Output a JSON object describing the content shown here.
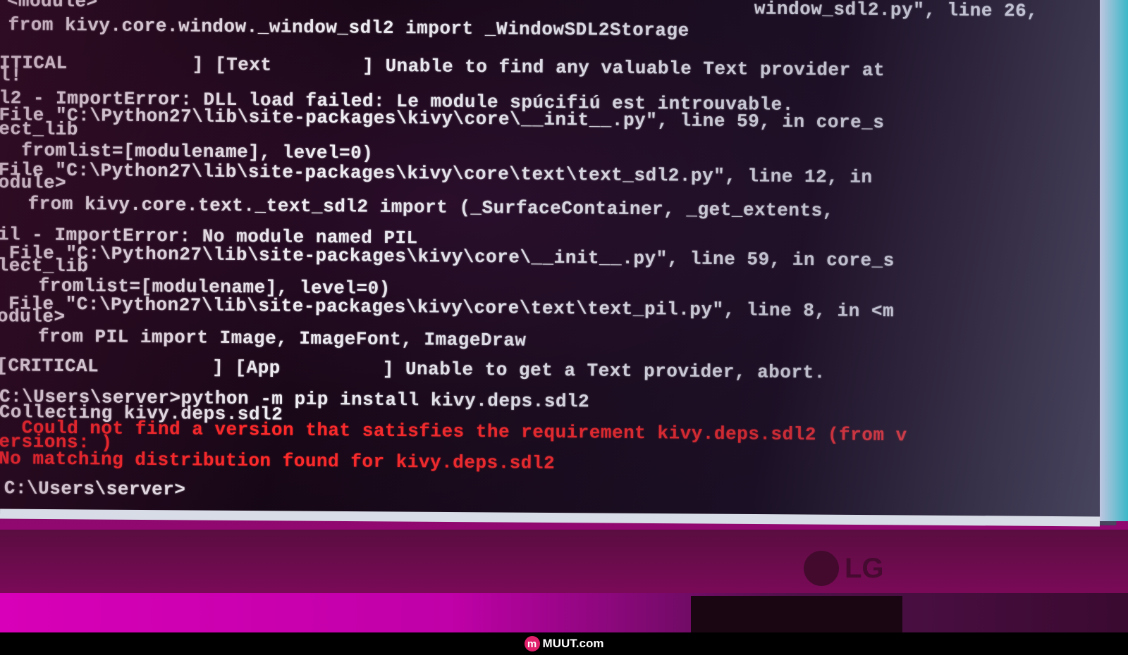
{
  "terminal": {
    "lines": [
      "<module>",
      "from kivy.core.window._window_sdl2 import _WindowSDL2Storage",
      "ITICAL           ] [Text        ] Unable to find any valuable Text provider at",
      "l!",
      "l2 - ImportError: DLL load failed: Le module spúcifiú est introuvable.",
      "File \"C:\\Python27\\lib\\site-packages\\kivy\\core\\__init__.py\", line 59, in core_s",
      "ect_lib",
      "  fromlist=[modulename], level=0)",
      "File \"C:\\Python27\\lib\\site-packages\\kivy\\core\\text\\text_sdl2.py\", line 12, in",
      "odule>",
      "  from kivy.core.text._text_sdl2 import (_SurfaceContainer, _get_extents,",
      "il - ImportError: No module named PIL",
      " File \"C:\\Python27\\lib\\site-packages\\kivy\\core\\__init__.py\", line 59, in core_s",
      "lect_lib",
      "   fromlist=[modulename], level=0)",
      " File \"C:\\Python27\\lib\\site-packages\\kivy\\core\\text\\text_pil.py\", line 8, in <m",
      "odule>",
      "   from PIL import Image, ImageFont, ImageDraw",
      "[CRITICAL          ] [App         ] Unable to get a Text provider, abort.",
      "C:\\Users\\server>python -m pip install kivy.deps.sdl2",
      "Collecting kivy.deps.sdl2"
    ],
    "top_right_fragment": "window_sdl2.py\", line 26,",
    "errors": [
      "  Could not find a version that satisfies the requirement kivy.deps.sdl2 (from v",
      "ersions: )",
      "No matching distribution found for kivy.deps.sdl2"
    ],
    "prompt": "C:\\Users\\server>"
  },
  "monitor": {
    "brand": "LG"
  },
  "watermark": {
    "icon_letter": "m",
    "text": "MUUT.com"
  },
  "colors": {
    "error": "#ff2a2a",
    "text": "#f0eef4",
    "background": "#1a0818"
  }
}
